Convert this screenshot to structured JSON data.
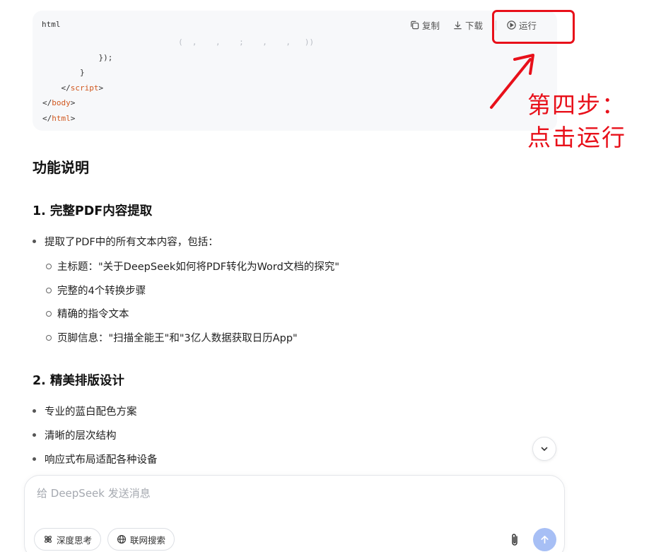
{
  "code_block": {
    "language": "html",
    "actions": {
      "copy": "复制",
      "download": "下载",
      "run": "运行"
    },
    "lines": [
      {
        "indent": "            ",
        "text": "});"
      },
      {
        "indent": "        ",
        "text": "}"
      },
      {
        "indent": "    ",
        "open": "</",
        "tag": "script",
        "close": ">"
      },
      {
        "indent": "",
        "open": "</",
        "tag": "body",
        "close": ">"
      },
      {
        "indent": "",
        "open": "</",
        "tag": "html",
        "close": ">"
      }
    ],
    "partial_line": "(  ,    ,    ;    ,    ,   ))"
  },
  "annotation": {
    "line1": "第四步：",
    "line2": "点击运行",
    "color": "#e8101a"
  },
  "content": {
    "heading": "功能说明",
    "section1": {
      "title": "1. 完整PDF内容提取",
      "bullet": "提取了PDF中的所有文本内容，包括：",
      "subitems": [
        "主标题：\"关于DeepSeek如何将PDF转化为Word文档的探究\"",
        "完整的4个转换步骤",
        "精确的指令文本",
        "页脚信息：\"扫描全能王\"和\"3亿人数据获取日历App\""
      ]
    },
    "section2": {
      "title": "2. 精美排版设计",
      "bullets": [
        "专业的蓝白配色方案",
        "清晰的层次结构",
        "响应式布局适配各种设备"
      ]
    }
  },
  "composer": {
    "placeholder": "给 DeepSeek 发送消息",
    "deep_think": "深度思考",
    "web_search": "联网搜索"
  },
  "colors": {
    "accent": "#a7bff5",
    "code_bg": "#f7f8fa",
    "tag": "#d1581f"
  }
}
